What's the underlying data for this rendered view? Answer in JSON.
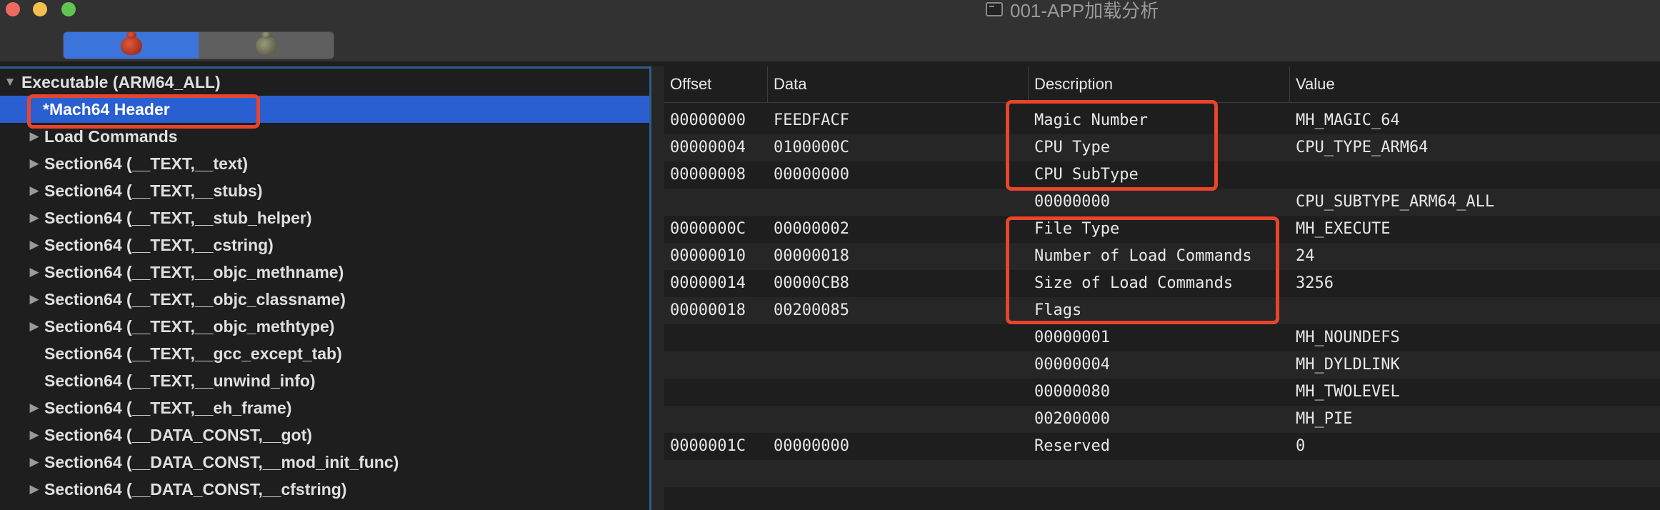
{
  "window": {
    "title": "001-APP加载分析"
  },
  "toolbar": {
    "segments": [
      {
        "icon": "bug-icon-red",
        "selected": true
      },
      {
        "icon": "bug-icon-grey",
        "selected": false
      }
    ]
  },
  "tree": {
    "root_label": "Executable  (ARM64_ALL)",
    "items": [
      {
        "label": "*Mach64 Header",
        "expandable": false,
        "selected": true
      },
      {
        "label": "Load Commands",
        "expandable": true
      },
      {
        "label": "Section64 (__TEXT,__text)",
        "expandable": true
      },
      {
        "label": "Section64 (__TEXT,__stubs)",
        "expandable": true
      },
      {
        "label": "Section64 (__TEXT,__stub_helper)",
        "expandable": true
      },
      {
        "label": "Section64 (__TEXT,__cstring)",
        "expandable": true
      },
      {
        "label": "Section64 (__TEXT,__objc_methname)",
        "expandable": true
      },
      {
        "label": "Section64 (__TEXT,__objc_classname)",
        "expandable": true
      },
      {
        "label": "Section64 (__TEXT,__objc_methtype)",
        "expandable": true
      },
      {
        "label": "Section64 (__TEXT,__gcc_except_tab)",
        "expandable": false
      },
      {
        "label": "Section64 (__TEXT,__unwind_info)",
        "expandable": false
      },
      {
        "label": "Section64 (__TEXT,__eh_frame)",
        "expandable": true
      },
      {
        "label": "Section64 (__DATA_CONST,__got)",
        "expandable": true
      },
      {
        "label": "Section64 (__DATA_CONST,__mod_init_func)",
        "expandable": true
      },
      {
        "label": "Section64 (__DATA_CONST,__cfstring)",
        "expandable": true
      }
    ]
  },
  "table": {
    "columns": [
      "Offset",
      "Data",
      "Description",
      "Value"
    ],
    "rows": [
      {
        "offset": "00000000",
        "data": "FEEDFACF",
        "description": "Magic Number",
        "value": "MH_MAGIC_64"
      },
      {
        "offset": "00000004",
        "data": "0100000C",
        "description": "CPU Type",
        "value": "CPU_TYPE_ARM64"
      },
      {
        "offset": "00000008",
        "data": "00000000",
        "description": "CPU SubType",
        "value": ""
      },
      {
        "offset": "",
        "data": "",
        "description": "00000000",
        "value": "CPU_SUBTYPE_ARM64_ALL"
      },
      {
        "offset": "0000000C",
        "data": "00000002",
        "description": "File Type",
        "value": "MH_EXECUTE"
      },
      {
        "offset": "00000010",
        "data": "00000018",
        "description": "Number of Load Commands",
        "value": "24"
      },
      {
        "offset": "00000014",
        "data": "00000CB8",
        "description": "Size of Load Commands",
        "value": "3256"
      },
      {
        "offset": "00000018",
        "data": "00200085",
        "description": "Flags",
        "value": ""
      },
      {
        "offset": "",
        "data": "",
        "description": "00000001",
        "value": "MH_NOUNDEFS"
      },
      {
        "offset": "",
        "data": "",
        "description": "00000004",
        "value": "MH_DYLDLINK"
      },
      {
        "offset": "",
        "data": "",
        "description": "00000080",
        "value": "MH_TWOLEVEL"
      },
      {
        "offset": "",
        "data": "",
        "description": "00200000",
        "value": "MH_PIE"
      },
      {
        "offset": "0000001C",
        "data": "00000000",
        "description": "Reserved",
        "value": "0"
      },
      {
        "offset": "",
        "data": "",
        "description": "",
        "value": ""
      }
    ]
  },
  "colors": {
    "selection": "#2a5fd1",
    "highlight_box": "#e8452b",
    "background": "#1e1e1e"
  }
}
